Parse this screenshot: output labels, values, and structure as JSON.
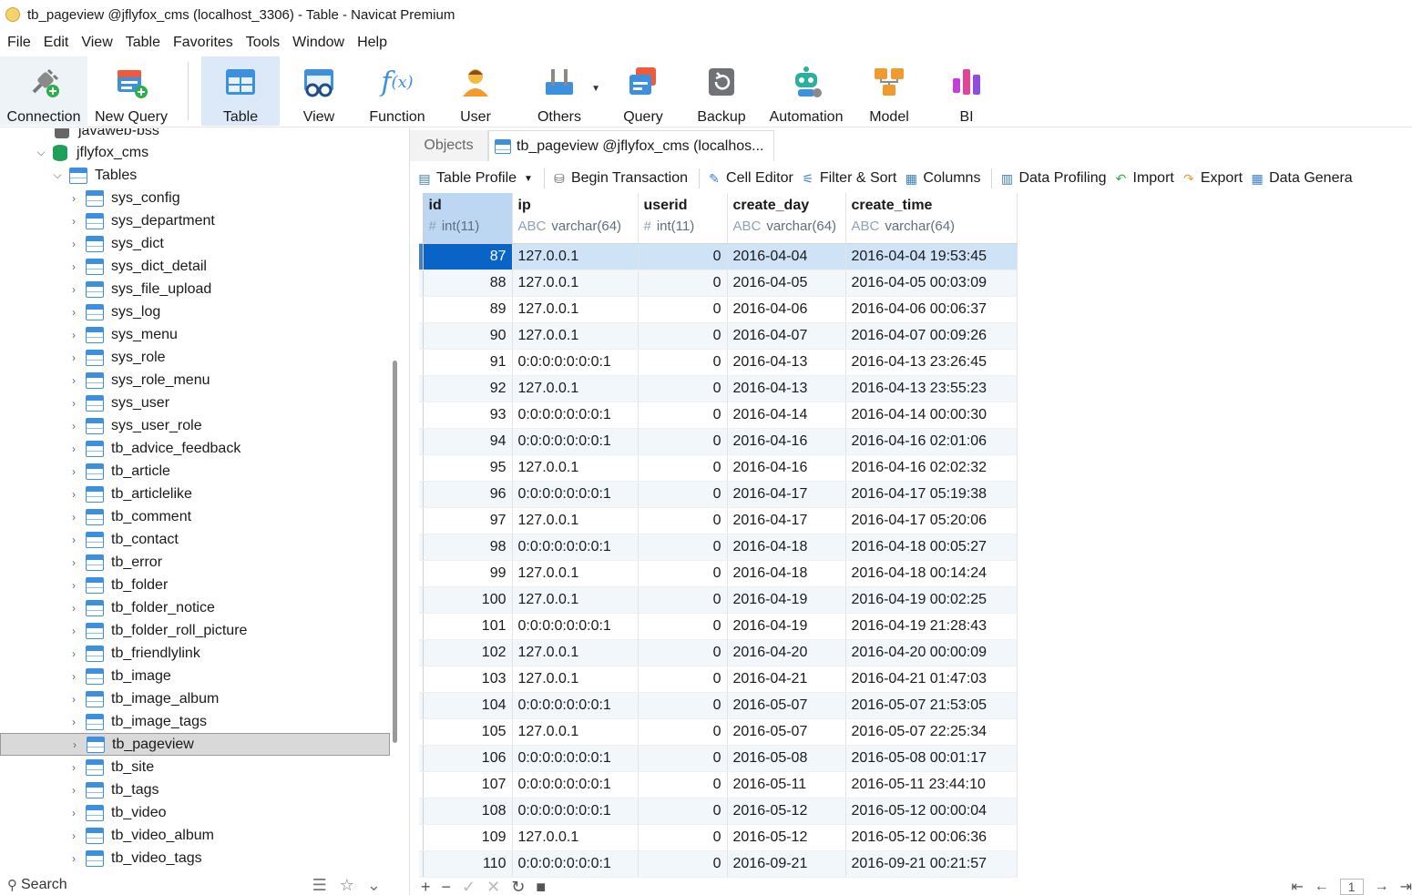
{
  "window": {
    "title": "tb_pageview @jflyfox_cms (localhost_3306) - Table - Navicat Premium"
  },
  "menu": [
    "File",
    "Edit",
    "View",
    "Table",
    "Favorites",
    "Tools",
    "Window",
    "Help"
  ],
  "toolbar": {
    "connection": "Connection",
    "new_query": "New Query",
    "table": "Table",
    "view": "View",
    "function": "Function",
    "user": "User",
    "others": "Others",
    "query": "Query",
    "backup": "Backup",
    "automation": "Automation",
    "model": "Model",
    "bi": "BI"
  },
  "sidebar": {
    "server_partial": "javaweb-bss",
    "database": "jflyfox_cms",
    "tables_node": "Tables",
    "tables": [
      "sys_config",
      "sys_department",
      "sys_dict",
      "sys_dict_detail",
      "sys_file_upload",
      "sys_log",
      "sys_menu",
      "sys_role",
      "sys_role_menu",
      "sys_user",
      "sys_user_role",
      "tb_advice_feedback",
      "tb_article",
      "tb_articlelike",
      "tb_comment",
      "tb_contact",
      "tb_error",
      "tb_folder",
      "tb_folder_notice",
      "tb_folder_roll_picture",
      "tb_friendlylink",
      "tb_image",
      "tb_image_album",
      "tb_image_tags",
      "tb_pageview",
      "tb_site",
      "tb_tags",
      "tb_video",
      "tb_video_album",
      "tb_video_tags"
    ],
    "selected": "tb_pageview",
    "search_label": "Search"
  },
  "tabs": {
    "objects": "Objects",
    "active": "tb_pageview @jflyfox_cms (localhos..."
  },
  "subtoolbar": {
    "table_profile": "Table Profile",
    "begin_transaction": "Begin Transaction",
    "cell_editor": "Cell Editor",
    "filter_sort": "Filter & Sort",
    "columns": "Columns",
    "data_profiling": "Data Profiling",
    "import": "Import",
    "export": "Export",
    "data_generation": "Data Genera"
  },
  "grid": {
    "columns": [
      {
        "name": "id",
        "type": "int(11)",
        "sym": "#"
      },
      {
        "name": "ip",
        "type": "varchar(64)",
        "sym": "ABC"
      },
      {
        "name": "userid",
        "type": "int(11)",
        "sym": "#"
      },
      {
        "name": "create_day",
        "type": "varchar(64)",
        "sym": "ABC"
      },
      {
        "name": "create_time",
        "type": "varchar(64)",
        "sym": "ABC"
      }
    ],
    "rows": [
      [
        "87",
        "127.0.0.1",
        "0",
        "2016-04-04",
        "2016-04-04 19:53:45"
      ],
      [
        "88",
        "127.0.0.1",
        "0",
        "2016-04-05",
        "2016-04-05 00:03:09"
      ],
      [
        "89",
        "127.0.0.1",
        "0",
        "2016-04-06",
        "2016-04-06 00:06:37"
      ],
      [
        "90",
        "127.0.0.1",
        "0",
        "2016-04-07",
        "2016-04-07 00:09:26"
      ],
      [
        "91",
        "0:0:0:0:0:0:0:1",
        "0",
        "2016-04-13",
        "2016-04-13 23:26:45"
      ],
      [
        "92",
        "127.0.0.1",
        "0",
        "2016-04-13",
        "2016-04-13 23:55:23"
      ],
      [
        "93",
        "0:0:0:0:0:0:0:1",
        "0",
        "2016-04-14",
        "2016-04-14 00:00:30"
      ],
      [
        "94",
        "0:0:0:0:0:0:0:1",
        "0",
        "2016-04-16",
        "2016-04-16 02:01:06"
      ],
      [
        "95",
        "127.0.0.1",
        "0",
        "2016-04-16",
        "2016-04-16 02:02:32"
      ],
      [
        "96",
        "0:0:0:0:0:0:0:1",
        "0",
        "2016-04-17",
        "2016-04-17 05:19:38"
      ],
      [
        "97",
        "127.0.0.1",
        "0",
        "2016-04-17",
        "2016-04-17 05:20:06"
      ],
      [
        "98",
        "0:0:0:0:0:0:0:1",
        "0",
        "2016-04-18",
        "2016-04-18 00:05:27"
      ],
      [
        "99",
        "127.0.0.1",
        "0",
        "2016-04-18",
        "2016-04-18 00:14:24"
      ],
      [
        "100",
        "127.0.0.1",
        "0",
        "2016-04-19",
        "2016-04-19 00:02:25"
      ],
      [
        "101",
        "0:0:0:0:0:0:0:1",
        "0",
        "2016-04-19",
        "2016-04-19 21:28:43"
      ],
      [
        "102",
        "127.0.0.1",
        "0",
        "2016-04-20",
        "2016-04-20 00:00:09"
      ],
      [
        "103",
        "127.0.0.1",
        "0",
        "2016-04-21",
        "2016-04-21 01:47:03"
      ],
      [
        "104",
        "0:0:0:0:0:0:0:1",
        "0",
        "2016-05-07",
        "2016-05-07 21:53:05"
      ],
      [
        "105",
        "127.0.0.1",
        "0",
        "2016-05-07",
        "2016-05-07 22:25:34"
      ],
      [
        "106",
        "0:0:0:0:0:0:0:1",
        "0",
        "2016-05-08",
        "2016-05-08 00:01:17"
      ],
      [
        "107",
        "0:0:0:0:0:0:0:1",
        "0",
        "2016-05-11",
        "2016-05-11 23:44:10"
      ],
      [
        "108",
        "0:0:0:0:0:0:0:1",
        "0",
        "2016-05-12",
        "2016-05-12 00:00:04"
      ],
      [
        "109",
        "127.0.0.1",
        "0",
        "2016-05-12",
        "2016-05-12 00:06:36"
      ],
      [
        "110",
        "0:0:0:0:0:0:0:1",
        "0",
        "2016-09-21",
        "2016-09-21 00:21:57"
      ]
    ]
  },
  "pager": {
    "page": "1"
  },
  "colors": {
    "accent": "#0a64c8",
    "selected_row": "#cfe3f7",
    "toolbar_active": "#dbe9f8"
  }
}
